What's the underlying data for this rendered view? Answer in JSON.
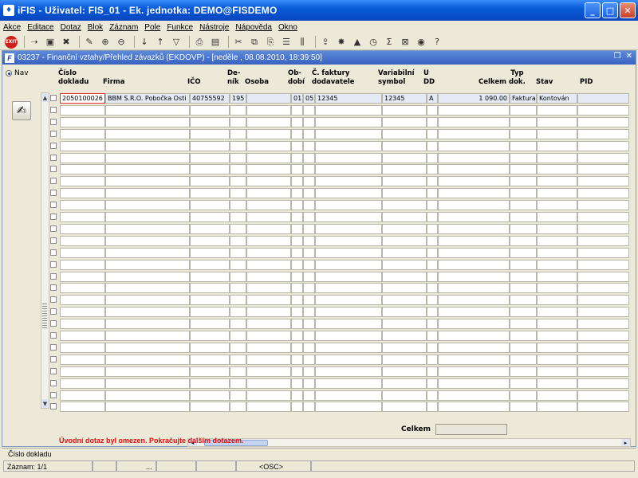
{
  "window": {
    "icon": "fis-app-icon",
    "title": "iFIS - Uživatel: FIS_01 - Ek. jednotka: DEMO@FISDEMO"
  },
  "menu": [
    "Akce",
    "Editace",
    "Dotaz",
    "Blok",
    "Záznam",
    "Pole",
    "Funkce",
    "Nástroje",
    "Nápověda",
    "Okno"
  ],
  "toolbar_icons": [
    "exit-icon",
    "arrow-right-icon",
    "save-icon",
    "delete-icon",
    "edit-icon",
    "insert-icon",
    "remove-icon",
    "sort-asc-icon",
    "sort-desc-icon",
    "filter-icon",
    "print-icon",
    "print-preview-icon",
    "cut-icon",
    "copy-icon",
    "paste-icon",
    "list-icon",
    "columns-icon",
    "export-icon",
    "star-icon",
    "triangle-icon",
    "clock-icon",
    "sum-icon",
    "excel-icon",
    "help-icon",
    "question-icon"
  ],
  "form": {
    "title": "03237 - Finanční vztahy/Přehled závazků (EKDOVP) - [neděle , 08.08.2010, 18:39:50]"
  },
  "nav_label": "Nav",
  "columns": [
    {
      "label": "Číslo\ndokladu"
    },
    {
      "label": "Firma"
    },
    {
      "label": "IČO"
    },
    {
      "label": "De-\nník"
    },
    {
      "label": "Osoba"
    },
    {
      "label": "Ob-\ndobí"
    },
    {
      "label": "Č. faktury\ndodavatele"
    },
    {
      "label": "Variabilní\nsymbol"
    },
    {
      "label": "U\nDD"
    },
    {
      "label": "Celkem"
    },
    {
      "label": "Typ\ndok."
    },
    {
      "label": "Stav"
    },
    {
      "label": "PID"
    }
  ],
  "rows": [
    [
      "2050100026",
      "BBM S.R.O. Pobočka Osti",
      "40755592",
      "195",
      "",
      "01",
      "05",
      "12345",
      "12345",
      "A",
      "1 090.00",
      "Faktura",
      "Kontován",
      ""
    ]
  ],
  "total_label": "Celkem",
  "total_value": "",
  "message": "Úvodní dotaz byl omezen. Pokračujte dalším dotazem.",
  "status": {
    "field_hint": "Číslo dokladu",
    "record": "Záznam: 1/1",
    "dots": "...",
    "osc": "<OSC>"
  }
}
